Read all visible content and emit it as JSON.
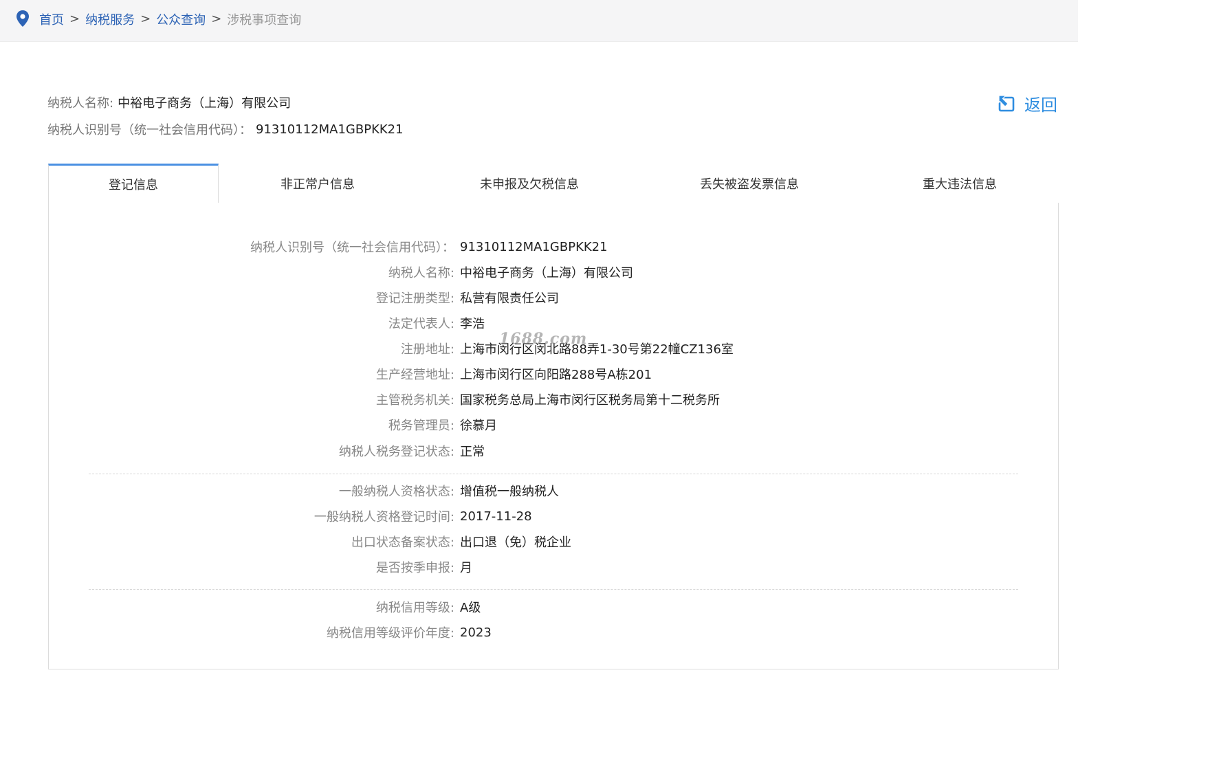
{
  "breadcrumb": {
    "items": [
      "首页",
      "纳税服务",
      "公众查询"
    ],
    "separator": ">",
    "current": "涉税事项查询"
  },
  "taxpayer": {
    "name_label": "纳税人名称:",
    "name_value": "中裕电子商务（上海）有限公司",
    "id_label": "纳税人识别号（统一社会信用代码）：",
    "id_value": "91310112MA1GBPKK21"
  },
  "back_button": {
    "label": "返回",
    "icon": "back-arrow-icon"
  },
  "tabs": [
    {
      "label": "登记信息",
      "active": true
    },
    {
      "label": "非正常户信息",
      "active": false
    },
    {
      "label": "未申报及欠税信息",
      "active": false
    },
    {
      "label": "丢失被盗发票信息",
      "active": false
    },
    {
      "label": "重大违法信息",
      "active": false
    }
  ],
  "details": {
    "group1": [
      {
        "label": "纳税人识别号（统一社会信用代码）：",
        "value": "91310112MA1GBPKK21"
      },
      {
        "label": "纳税人名称:",
        "value": "中裕电子商务（上海）有限公司"
      },
      {
        "label": "登记注册类型:",
        "value": "私营有限责任公司"
      },
      {
        "label": "法定代表人:",
        "value": "李浩"
      },
      {
        "label": "注册地址:",
        "value": "上海市闵行区闵北路88弄1-30号第22幢CZ136室"
      },
      {
        "label": "生产经营地址:",
        "value": "上海市闵行区向阳路288号A栋201"
      },
      {
        "label": "主管税务机关:",
        "value": "国家税务总局上海市闵行区税务局第十二税务所"
      },
      {
        "label": "税务管理员:",
        "value": "徐慕月"
      },
      {
        "label": "纳税人税务登记状态:",
        "value": "正常"
      }
    ],
    "group2": [
      {
        "label": "一般纳税人资格状态:",
        "value": "增值税一般纳税人"
      },
      {
        "label": "一般纳税人资格登记时间:",
        "value": "2017-11-28"
      },
      {
        "label": "出口状态备案状态:",
        "value": "出口退（免）税企业"
      },
      {
        "label": "是否按季申报:",
        "value": "月"
      }
    ],
    "group3": [
      {
        "label": "纳税信用等级:",
        "value": "A级"
      },
      {
        "label": "纳税信用等级评价年度:",
        "value": "2023"
      }
    ]
  },
  "watermark": "1688.com",
  "colors": {
    "link": "#2d63b5",
    "accent": "#4a90e2",
    "back": "#2e8de0",
    "label": "#888888"
  }
}
